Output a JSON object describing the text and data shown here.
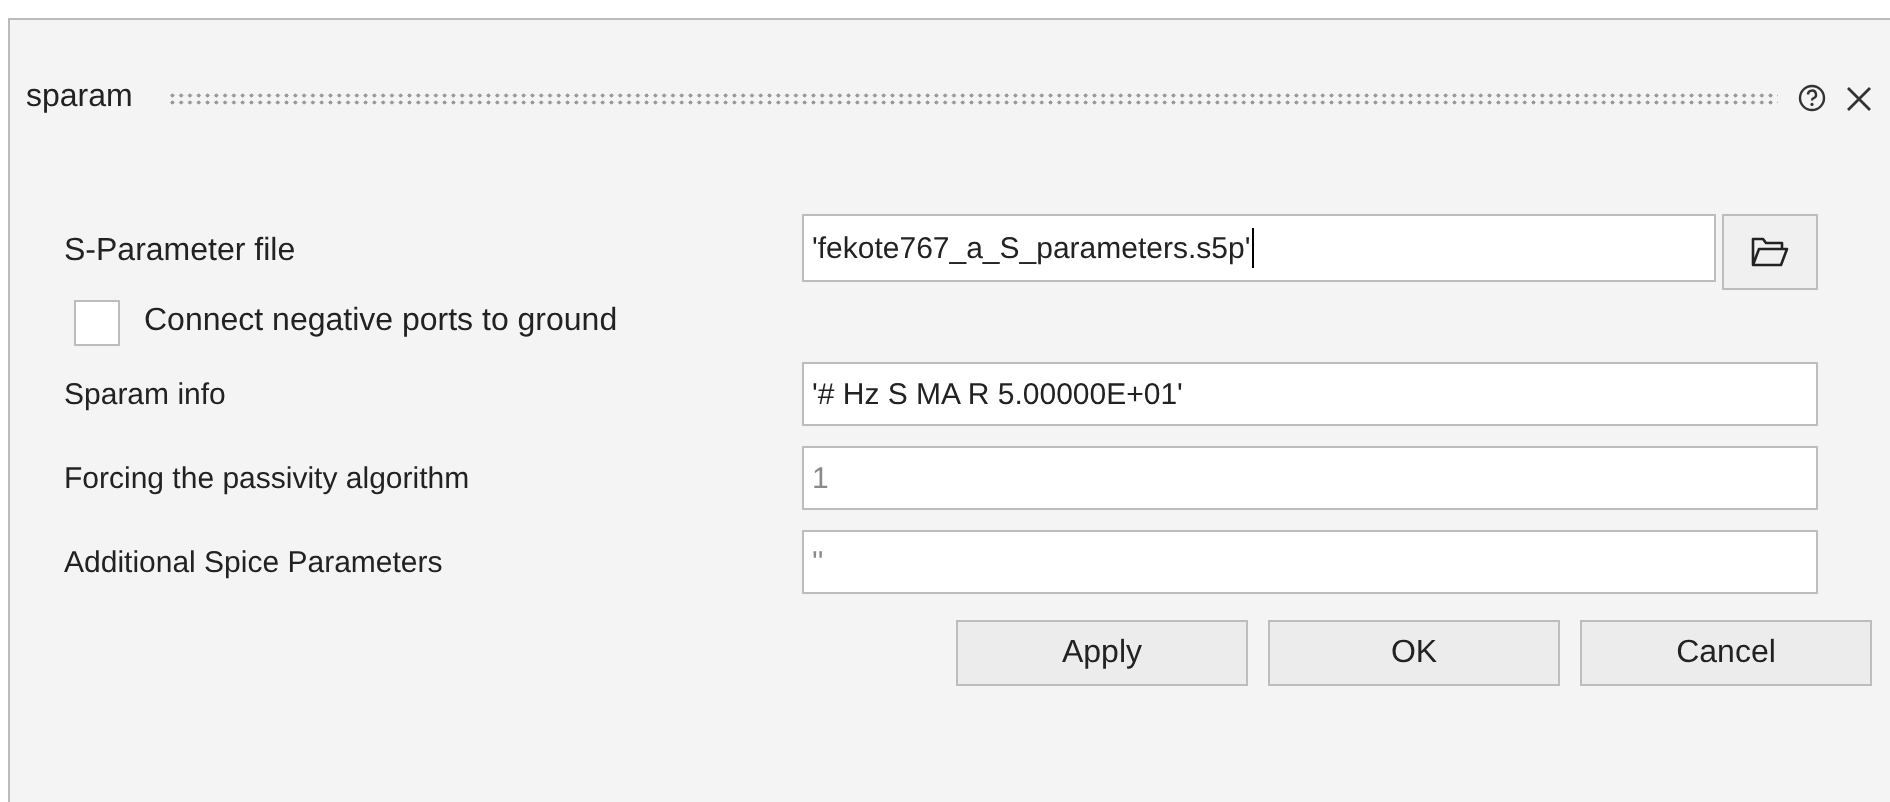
{
  "window": {
    "title": "sparam"
  },
  "file_field": {
    "label": "S-Parameter file",
    "value": "'fekote767_a_S_parameters.s5p'"
  },
  "checkbox": {
    "label": "Connect negative ports to ground",
    "checked": false
  },
  "fields": [
    {
      "label": "Sparam info",
      "value": "'# Hz S MA R  5.00000E+01'",
      "disabled": false
    },
    {
      "label": "Forcing the passivity algorithm",
      "value": "1",
      "disabled": true
    },
    {
      "label": "Additional Spice Parameters",
      "value": "''",
      "disabled": true
    }
  ],
  "buttons": [
    "Apply",
    "OK",
    "Cancel"
  ]
}
